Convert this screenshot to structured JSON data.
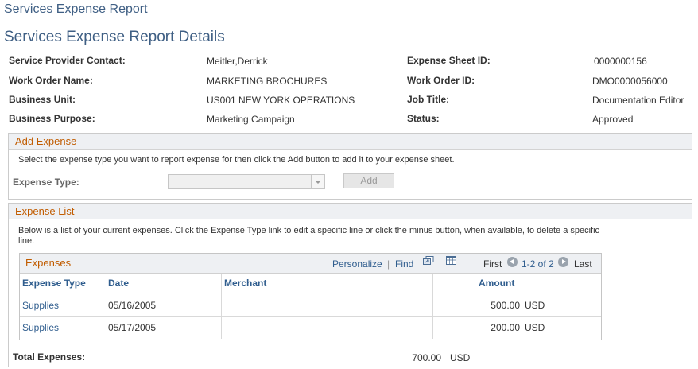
{
  "app": {
    "title": "Services Expense Report"
  },
  "page": {
    "title": "Services Expense Report Details"
  },
  "details": {
    "service_provider_contact": {
      "label": "Service Provider Contact:",
      "value": "Meitler,Derrick"
    },
    "work_order_name": {
      "label": "Work Order Name:",
      "value": "MARKETING BROCHURES"
    },
    "business_unit": {
      "label": "Business Unit:",
      "value": "US001 NEW YORK OPERATIONS"
    },
    "business_purpose": {
      "label": "Business Purpose:",
      "value": "Marketing Campaign"
    },
    "expense_sheet_id": {
      "label": "Expense Sheet ID:",
      "value": "0000000156"
    },
    "work_order_id": {
      "label": "Work Order ID:",
      "value": "DMO0000056000"
    },
    "job_title": {
      "label": "Job Title:",
      "value": "Documentation Editor"
    },
    "status": {
      "label": "Status:",
      "value": "Approved"
    }
  },
  "add_expense": {
    "title": "Add Expense",
    "instructions": "Select the expense type you want to report expense for then click the Add button to add it to your expense sheet.",
    "expense_type_label": "Expense Type:",
    "expense_type_value": "",
    "add_button": "Add"
  },
  "expense_list": {
    "title": "Expense List",
    "instructions_line1": "Below is a list of your current expenses. Click the Expense Type link to edit a specific line or click the minus button, when available, to delete a specific",
    "instructions_line2": "line.",
    "grid": {
      "title": "Expenses",
      "personalize": "Personalize",
      "separator": "|",
      "find": "Find",
      "first": "First",
      "range": "1-2 of 2",
      "last": "Last",
      "columns": [
        "Expense Type",
        "Date",
        "Merchant",
        "Amount"
      ],
      "rows": [
        {
          "expense_type": "Supplies",
          "date": "05/16/2005",
          "merchant": "",
          "amount": "500.00",
          "currency": "USD"
        },
        {
          "expense_type": "Supplies",
          "date": "05/17/2005",
          "merchant": "",
          "amount": "200.00",
          "currency": "USD"
        }
      ]
    },
    "total": {
      "label": "Total Expenses:",
      "amount": "700.00",
      "currency": "USD"
    }
  },
  "colors": {
    "title_blue": "#3f5f84",
    "section_orange": "#c15c00",
    "link_blue": "#2f5d8e"
  },
  "icons": [
    "view-all-icon",
    "download-to-excel-icon",
    "previous-arrow-icon",
    "next-arrow-icon",
    "dropdown-arrow-icon"
  ]
}
